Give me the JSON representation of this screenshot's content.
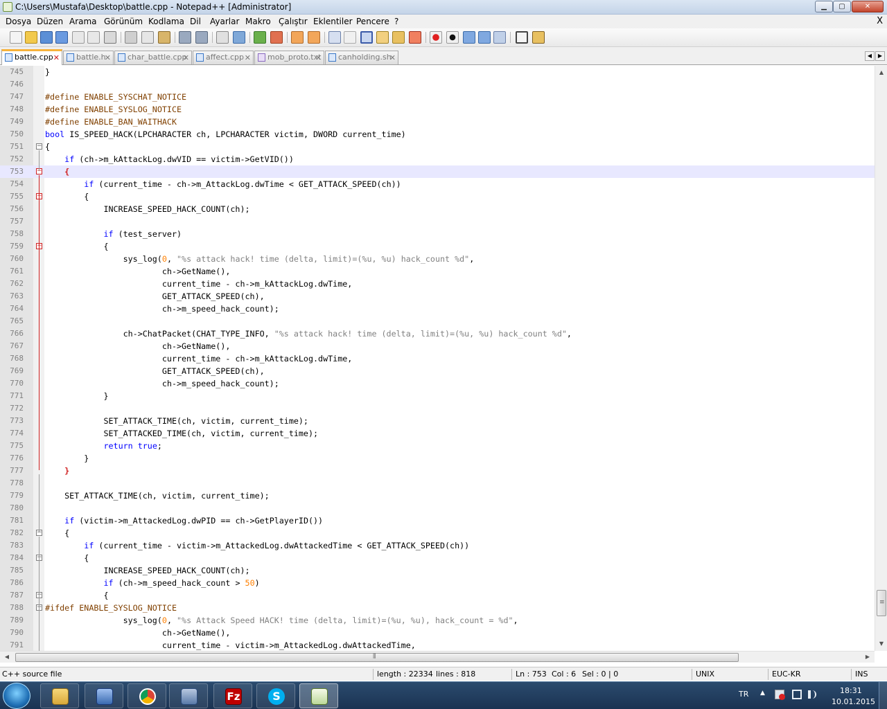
{
  "window": {
    "title": "C:\\Users\\Mustafa\\Desktop\\battle.cpp - Notepad++ [Administrator]",
    "min_glyph": "▁",
    "max_glyph": "▢",
    "close_glyph": "✕"
  },
  "menu": {
    "items": [
      "Dosya",
      "Düzen",
      "Arama",
      "Görünüm",
      "Kodlama",
      "Dil",
      "Ayarlar",
      "Makro",
      "Çalıştır",
      "Eklentiler",
      "Pencere",
      "?"
    ],
    "close_label": "X"
  },
  "tabs": [
    {
      "label": "battle.cpp",
      "active": true
    },
    {
      "label": "battle.h",
      "active": false
    },
    {
      "label": "char_battle.cpp",
      "active": false
    },
    {
      "label": "affect.cpp",
      "active": false
    },
    {
      "label": "mob_proto.txt",
      "active": false
    },
    {
      "label": "canholding.sh",
      "active": false
    }
  ],
  "tab_close_glyph": "✕",
  "editor": {
    "current_line": 753,
    "lines": [
      {
        "n": "745",
        "t": "}"
      },
      {
        "n": "746",
        "t": ""
      },
      {
        "n": "747",
        "t": "#define ENABLE_SYSCHAT_NOTICE"
      },
      {
        "n": "748",
        "t": "#define ENABLE_SYSLOG_NOTICE"
      },
      {
        "n": "749",
        "t": "#define ENABLE_BAN_WAITHACK"
      },
      {
        "n": "750",
        "t": "bool IS_SPEED_HACK(LPCHARACTER ch, LPCHARACTER victim, DWORD current_time)"
      },
      {
        "n": "751",
        "t": "{"
      },
      {
        "n": "752",
        "t": "    if (ch->m_kAttackLog.dwVID == victim->GetVID())"
      },
      {
        "n": "753",
        "t": "    {"
      },
      {
        "n": "754",
        "t": "        if (current_time - ch->m_AttackLog.dwTime < GET_ATTACK_SPEED(ch))"
      },
      {
        "n": "755",
        "t": "        {"
      },
      {
        "n": "756",
        "t": "            INCREASE_SPEED_HACK_COUNT(ch);"
      },
      {
        "n": "757",
        "t": ""
      },
      {
        "n": "758",
        "t": "            if (test_server)"
      },
      {
        "n": "759",
        "t": "            {"
      },
      {
        "n": "760",
        "t": "                sys_log(0, \"%s attack hack! time (delta, limit)=(%u, %u) hack_count %d\","
      },
      {
        "n": "761",
        "t": "                        ch->GetName(),"
      },
      {
        "n": "762",
        "t": "                        current_time - ch->m_kAttackLog.dwTime,"
      },
      {
        "n": "763",
        "t": "                        GET_ATTACK_SPEED(ch),"
      },
      {
        "n": "764",
        "t": "                        ch->m_speed_hack_count);"
      },
      {
        "n": "765",
        "t": ""
      },
      {
        "n": "766",
        "t": "                ch->ChatPacket(CHAT_TYPE_INFO, \"%s attack hack! time (delta, limit)=(%u, %u) hack_count %d\","
      },
      {
        "n": "767",
        "t": "                        ch->GetName(),"
      },
      {
        "n": "768",
        "t": "                        current_time - ch->m_kAttackLog.dwTime,"
      },
      {
        "n": "769",
        "t": "                        GET_ATTACK_SPEED(ch),"
      },
      {
        "n": "770",
        "t": "                        ch->m_speed_hack_count);"
      },
      {
        "n": "771",
        "t": "            }"
      },
      {
        "n": "772",
        "t": ""
      },
      {
        "n": "773",
        "t": "            SET_ATTACK_TIME(ch, victim, current_time);"
      },
      {
        "n": "774",
        "t": "            SET_ATTACKED_TIME(ch, victim, current_time);"
      },
      {
        "n": "775",
        "t": "            return true;"
      },
      {
        "n": "776",
        "t": "        }"
      },
      {
        "n": "777",
        "t": "    }"
      },
      {
        "n": "778",
        "t": ""
      },
      {
        "n": "779",
        "t": "    SET_ATTACK_TIME(ch, victim, current_time);"
      },
      {
        "n": "780",
        "t": ""
      },
      {
        "n": "781",
        "t": "    if (victim->m_AttackedLog.dwPID == ch->GetPlayerID())"
      },
      {
        "n": "782",
        "t": "    {"
      },
      {
        "n": "783",
        "t": "        if (current_time - victim->m_AttackedLog.dwAttackedTime < GET_ATTACK_SPEED(ch))"
      },
      {
        "n": "784",
        "t": "        {"
      },
      {
        "n": "785",
        "t": "            INCREASE_SPEED_HACK_COUNT(ch);"
      },
      {
        "n": "786",
        "t": "            if (ch->m_speed_hack_count > 50)"
      },
      {
        "n": "787",
        "t": "            {"
      },
      {
        "n": "788",
        "t": "#ifdef ENABLE_SYSLOG_NOTICE"
      },
      {
        "n": "789",
        "t": "                sys_log(0, \"%s Attack Speed HACK! time (delta, limit)=(%u, %u), hack_count = %d\","
      },
      {
        "n": "790",
        "t": "                        ch->GetName(),"
      },
      {
        "n": "791",
        "t": "                        current_time - victim->m_AttackedLog.dwAttackedTime,"
      }
    ]
  },
  "statusbar": {
    "filetype": "C++ source file",
    "length": "length : 22334",
    "lines": "lines : 818",
    "ln": "Ln : 753",
    "col": "Col : 6",
    "sel": "Sel : 0 | 0",
    "eol": "UNIX",
    "encoding": "EUC-KR",
    "mode": "INS"
  },
  "taskbar": {
    "language": "TR",
    "time": "18:31",
    "date": "10.01.2015",
    "filezilla_glyph": "Fz",
    "skype_glyph": "S"
  },
  "scroll": {
    "up": "▲",
    "down": "▼",
    "left": "◀",
    "right": "▶",
    "grip": "≡",
    "hgrip": "⦀"
  },
  "colors": {
    "keyword": "#0000ff",
    "preprocessor": "#804000",
    "string": "#808080",
    "number": "#ff8000",
    "active_tab_accent": "#f7b23b",
    "current_line": "#e8e8ff"
  }
}
